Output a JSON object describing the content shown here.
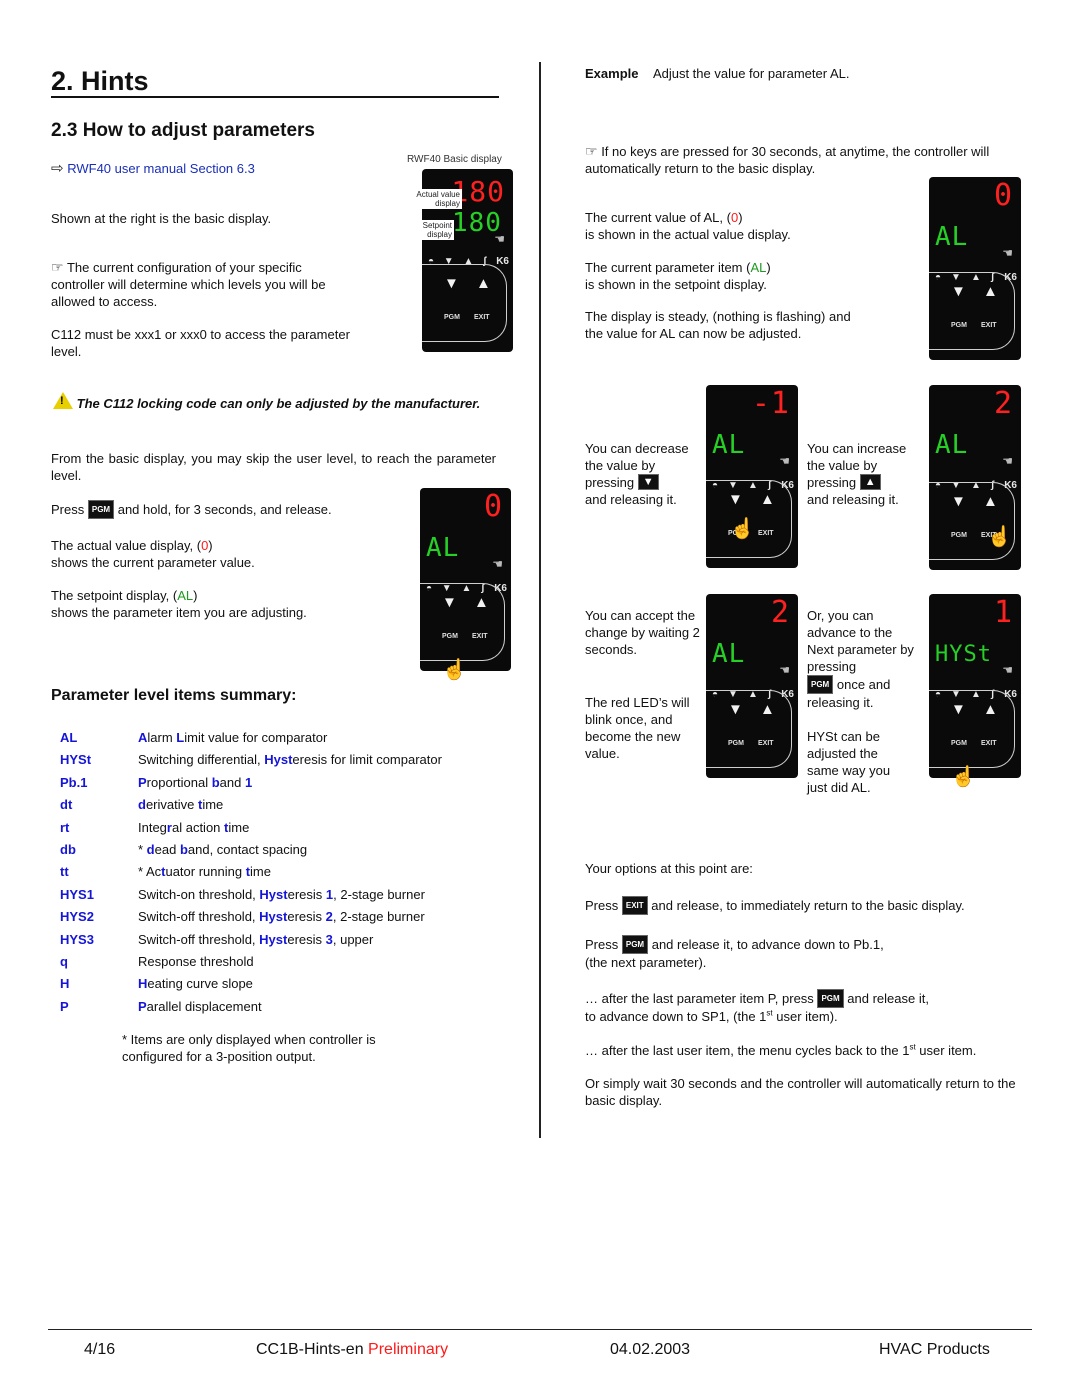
{
  "page": {
    "title": "2. Hints",
    "section": "2.3 How to adjust parameters",
    "reference": {
      "arrow_icon": "right-arrow-outline",
      "text": "RWF40 user manual Section 6.3"
    }
  },
  "left": {
    "basic_display_caption": "RWF40 Basic display",
    "basic_display_labels": {
      "actual": "Actual value display",
      "setpoint": "Setpoint display"
    },
    "p1": "Shown at the right is the basic display.",
    "note1": "The current configuration of your specific controller will determine which levels you will be allowed to access.",
    "p2": "C112 must be xxx1 or xxx0 to access the parameter level.",
    "warning": "The C112 locking code can only be adjusted by the manufacturer.",
    "p3": "From the basic display, you may skip the user level, to reach the parameter level.",
    "press_a": "Press",
    "press_b": "and hold, for 3 seconds, and release.",
    "actual_a": "The actual value display, (",
    "actual_val": "0",
    "actual_b": ")",
    "actual_c": "shows the current parameter value.",
    "setpoint_a": "The setpoint display, (",
    "setpoint_val": "AL",
    "setpoint_b": ")",
    "setpoint_c": "shows the parameter item you are adjusting.",
    "summary_title": "Parameter level items summary:",
    "params": [
      {
        "code": "AL",
        "desc": [
          {
            "t": "A",
            "b": 1
          },
          {
            "t": "larm "
          },
          {
            "t": "L",
            "b": 1
          },
          {
            "t": "imit value for comparator"
          }
        ]
      },
      {
        "code": "HYSt",
        "desc": [
          {
            "t": "Switching differential, "
          },
          {
            "t": "Hyst",
            "b": 1
          },
          {
            "t": "eresis for limit comparator"
          }
        ]
      },
      {
        "code": "Pb.1",
        "desc": [
          {
            "t": "P",
            "b": 1
          },
          {
            "t": "roportional "
          },
          {
            "t": "b",
            "b": 1
          },
          {
            "t": "and "
          },
          {
            "t": "1",
            "b": 1
          }
        ]
      },
      {
        "code": "dt",
        "desc": [
          {
            "t": "d",
            "b": 1
          },
          {
            "t": "erivative "
          },
          {
            "t": "t",
            "b": 1
          },
          {
            "t": "ime"
          }
        ]
      },
      {
        "code": "rt",
        "desc": [
          {
            "t": "Integ"
          },
          {
            "t": "r",
            "b": 1
          },
          {
            "t": "al action "
          },
          {
            "t": "t",
            "b": 1
          },
          {
            "t": "ime"
          }
        ]
      },
      {
        "code": "db",
        "desc": [
          {
            "t": "* "
          },
          {
            "t": "d",
            "b": 1
          },
          {
            "t": "ead "
          },
          {
            "t": "b",
            "b": 1
          },
          {
            "t": "and, contact spacing"
          }
        ]
      },
      {
        "code": "tt",
        "desc": [
          {
            "t": "* Ac"
          },
          {
            "t": "t",
            "b": 1
          },
          {
            "t": "uator running "
          },
          {
            "t": "t",
            "b": 1
          },
          {
            "t": "ime"
          }
        ]
      },
      {
        "code": "HYS1",
        "desc": [
          {
            "t": "Switch-on threshold, "
          },
          {
            "t": "Hyst",
            "b": 1
          },
          {
            "t": "eresis "
          },
          {
            "t": "1",
            "b": 1
          },
          {
            "t": ", 2-stage burner"
          }
        ]
      },
      {
        "code": "HYS2",
        "desc": [
          {
            "t": "Switch-off threshold, "
          },
          {
            "t": "Hyst",
            "b": 1
          },
          {
            "t": "eresis "
          },
          {
            "t": "2",
            "b": 1
          },
          {
            "t": ", 2-stage burner"
          }
        ]
      },
      {
        "code": "HYS3",
        "desc": [
          {
            "t": "Switch-off threshold, "
          },
          {
            "t": "Hyst",
            "b": 1
          },
          {
            "t": "eresis "
          },
          {
            "t": "3",
            "b": 1
          },
          {
            "t": ", upper"
          }
        ]
      },
      {
        "code": "q",
        "desc": [
          {
            "t": "Response threshold"
          }
        ]
      },
      {
        "code": "H",
        "desc": [
          {
            "t": "H",
            "b": 1
          },
          {
            "t": "eating curve slope"
          }
        ]
      },
      {
        "code": "P",
        "desc": [
          {
            "t": "P",
            "b": 1
          },
          {
            "t": "arallel displacement"
          }
        ]
      }
    ],
    "footnote": "* Items are only displayed when controller is configured for a 3-position output."
  },
  "right": {
    "example_label": "Example",
    "example_text": "Adjust the value for parameter AL.",
    "note2": "If no keys are pressed for 30 seconds, at anytime, the controller will automatically return to the basic display.",
    "cur_a": "The current value of AL, (",
    "cur_val": "0",
    "cur_b": ")",
    "cur_c": "is shown in the actual value display.",
    "item_a": "The current parameter item (",
    "item_val": "AL",
    "item_b": ")",
    "item_c": "is shown in the setpoint display.",
    "steady": "The display is steady, (nothing is flashing) and the value for AL can now be adjusted.",
    "decrease_a": "You can  decrease the value  by pressing",
    "decrease_b": "and releasing it.",
    "increase_a": "You can increase the value by pressing",
    "increase_b": "and releasing it.",
    "accept": "You can  accept the change by waiting 2  seconds.",
    "blink": "The red LED’s will blink once, and become the new value.",
    "advance_a": "Or, you can advance to the Next parameter by pressing",
    "advance_b": "once and releasing it.",
    "hyst_note": "HYSt can be adjusted the same way you just did AL.",
    "options": "Your options at this point are:",
    "exit_a": "Press",
    "exit_b": "and release, to immediately return to the basic display.",
    "pgm_a": "Press",
    "pgm_b": "and release it, to advance down to Pb.1,",
    "pgm_c": "(the next parameter).",
    "last_a": "… after the last parameter item P, press",
    "last_b": "and release it,",
    "last_c": "to advance down to SP1, (the 1",
    "last_sup": "st",
    "last_d": " user item).",
    "cycle_a": "… after the last user item, the menu cycles back to the 1",
    "cycle_sup": "st",
    "cycle_b": " user item.",
    "wait": "Or simply wait 30 seconds and the controller will automatically return to the basic display."
  },
  "keys": {
    "pgm": "PGM",
    "exit": "EXIT",
    "down": "▼",
    "up": "▲"
  },
  "controller": {
    "status_icons": [
      "◓",
      "▼",
      "▲",
      "ʃ",
      "K6"
    ],
    "hand_icon": "☚",
    "finger_icon": "☝",
    "pgm_label": "PGM",
    "exit_label": "EXIT",
    "displays": [
      {
        "id": "basic",
        "actual": "180",
        "setpoint": "180"
      },
      {
        "id": "enter",
        "actual": "0",
        "setpoint": "AL"
      },
      {
        "id": "example",
        "actual": "0",
        "setpoint": "AL"
      },
      {
        "id": "decrease",
        "actual": "-1",
        "setpoint": "AL"
      },
      {
        "id": "increase",
        "actual": "2",
        "setpoint": "AL"
      },
      {
        "id": "accept",
        "actual": "2",
        "setpoint": "AL"
      },
      {
        "id": "next",
        "actual": "1",
        "setpoint": "HYSt"
      }
    ]
  },
  "colors": {
    "link": "#1a2fb8",
    "param_code": "#1515d8",
    "led_red": "#ff2020",
    "led_green": "#26d026",
    "preliminary": "#ff1a1a"
  },
  "footer": {
    "page": "4/16",
    "doc": "CC1B-Hints-en",
    "status": "Preliminary",
    "date": "04.02.2003",
    "dept": "HVAC Products"
  }
}
